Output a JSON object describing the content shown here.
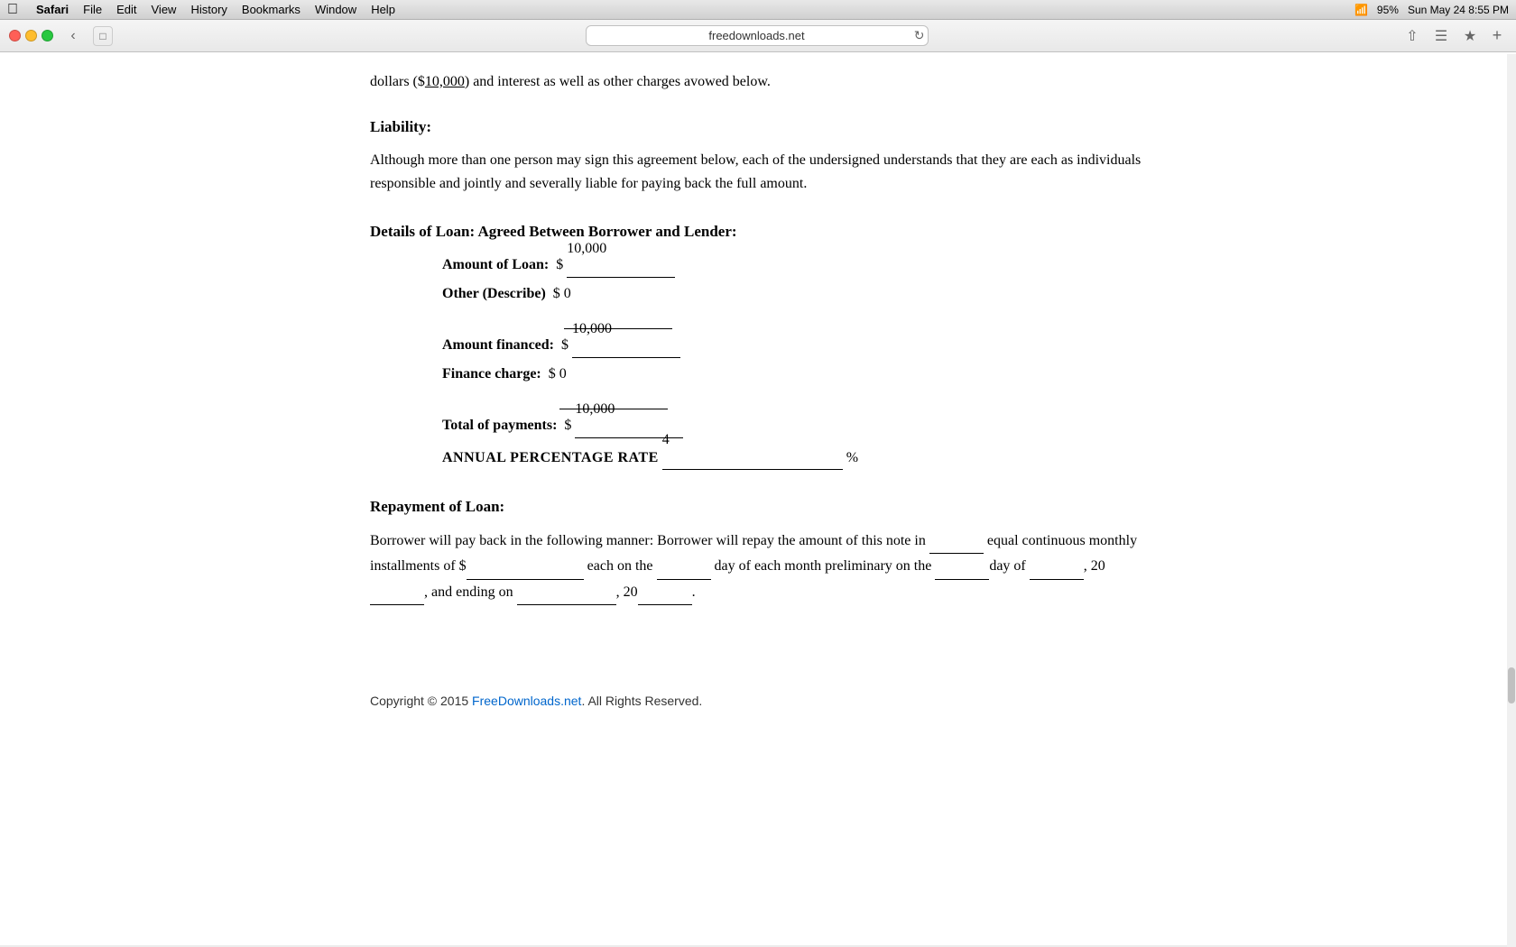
{
  "menubar": {
    "apple": "⌘",
    "items": [
      {
        "label": "Safari",
        "bold": true
      },
      {
        "label": "File"
      },
      {
        "label": "Edit"
      },
      {
        "label": "View"
      },
      {
        "label": "History"
      },
      {
        "label": "Bookmarks"
      },
      {
        "label": "Window"
      },
      {
        "label": "Help"
      }
    ],
    "right": {
      "battery": "95%",
      "datetime": "Sun May 24  8:55 PM"
    }
  },
  "browser": {
    "url": "freedownloads.net",
    "back_btn": "‹",
    "refresh_btn": "↺"
  },
  "page": {
    "intro": {
      "text_before": "dollars ($",
      "amount": "10,000",
      "text_after": ") and interest as well as other charges avowed below."
    },
    "liability": {
      "heading": "Liability:",
      "text": "Although more than one person may sign this agreement below, each of the undersigned understands that they are each as individuals responsible and jointly and severally liable for paying back the full amount."
    },
    "loan_details": {
      "heading": "Details of Loan: Agreed Between Borrower and Lender:",
      "rows": [
        {
          "label": "Amount of Loan:",
          "prefix": "$",
          "value_top": "10,000",
          "value_bottom": ""
        },
        {
          "label": "Other (Describe)",
          "prefix": "$",
          "value_top": "",
          "value_bottom": "0"
        },
        {
          "label": "Amount financed:",
          "prefix": "$",
          "value_top": "10,000",
          "value_bottom": ""
        },
        {
          "label": "Finance charge:",
          "prefix": "$",
          "value_top": "",
          "value_bottom": "0"
        },
        {
          "label": "Total of payments:",
          "prefix": "$",
          "value_top": "10,000",
          "value_bottom": ""
        }
      ],
      "apr": {
        "label": "ANNUAL PERCENTAGE RATE",
        "value": "4",
        "suffix": "%"
      }
    },
    "repayment": {
      "heading": "Repayment of Loan:",
      "text_parts": [
        "Borrower will pay back in the following manner: Borrower will repay the amount of this note in",
        "equal continuous monthly installments of $",
        "each on the",
        "day of each month preliminary on the",
        "day of",
        ", 20",
        ", and ending on",
        ", 20",
        "."
      ]
    },
    "footer": {
      "copyright": "Copyright © 2015 ",
      "link_text": "FreeDownloads.net",
      "link_href": "#",
      "suffix": ". All Rights Reserved."
    }
  }
}
